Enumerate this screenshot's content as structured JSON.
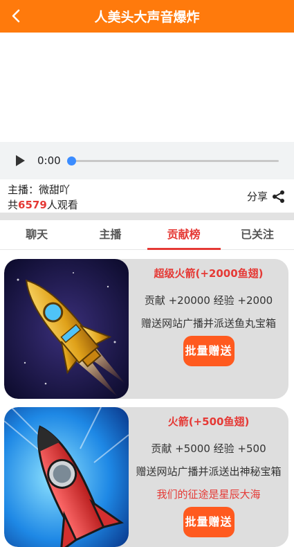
{
  "header": {
    "title": "人美头大声音爆炸",
    "back_icon": "chevron-left-icon"
  },
  "player": {
    "time": "0:00",
    "progress": 0
  },
  "info": {
    "anchor_label": "主播：微甜吖",
    "viewers_prefix": "共",
    "viewers_count": "6579",
    "viewers_suffix": "人观看",
    "share_label": "分享"
  },
  "tabs": [
    {
      "label": "聊天"
    },
    {
      "label": "主播"
    },
    {
      "label": "贡献榜"
    },
    {
      "label": "已关注"
    }
  ],
  "active_tab": 2,
  "gifts": [
    {
      "name": "超级火箭(+2000鱼翅)",
      "stats": "贡献 +20000 经验 +2000",
      "desc": "赠送网站广播并派送鱼丸宝箱",
      "button": "批量赠送"
    },
    {
      "name": "火箭(+500鱼翅)",
      "stats": "贡献 +5000 经验 +500",
      "desc": "赠送网站广播并派送出神秘宝箱",
      "slogan": "我们的征途是星辰大海",
      "button": "批量赠送"
    }
  ],
  "colors": {
    "header": "#ff7a0c",
    "accent": "#e53935",
    "button": "#ff5a1f"
  }
}
